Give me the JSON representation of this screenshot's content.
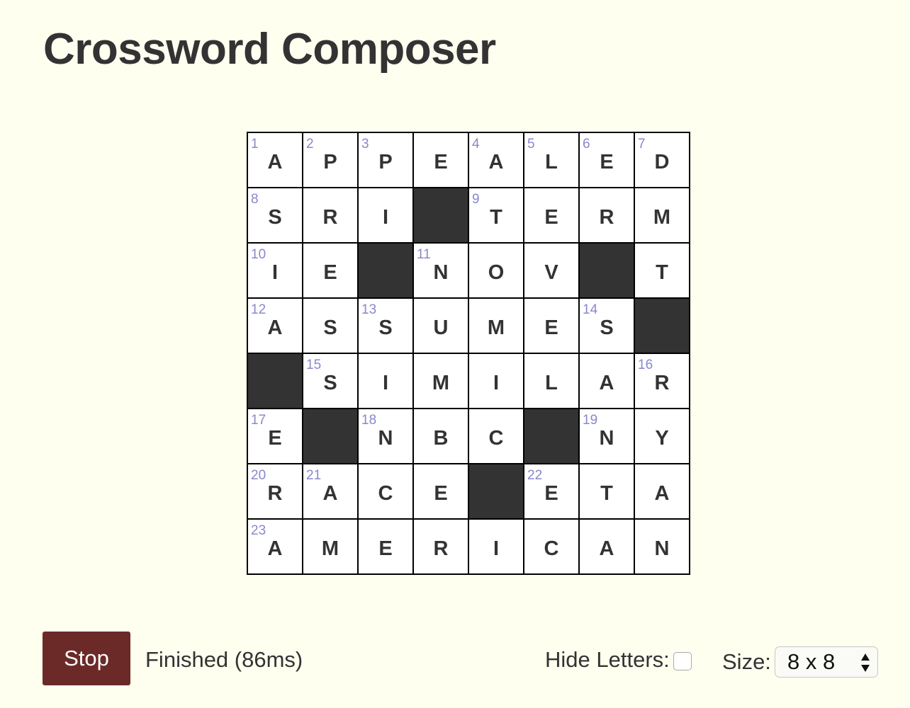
{
  "header": {
    "title": "Crossword Composer"
  },
  "grid": {
    "rows": 8,
    "cols": 8,
    "colors": {
      "black_cell": "#333333",
      "number": "#8888cc",
      "letter": "#333333"
    },
    "cells": [
      [
        {
          "n": "1",
          "l": "A"
        },
        {
          "n": "2",
          "l": "P"
        },
        {
          "n": "3",
          "l": "P"
        },
        {
          "n": "",
          "l": "E"
        },
        {
          "n": "4",
          "l": "A"
        },
        {
          "n": "5",
          "l": "L"
        },
        {
          "n": "6",
          "l": "E"
        },
        {
          "n": "7",
          "l": "D"
        }
      ],
      [
        {
          "n": "8",
          "l": "S"
        },
        {
          "n": "",
          "l": "R"
        },
        {
          "n": "",
          "l": "I"
        },
        {
          "black": true
        },
        {
          "n": "9",
          "l": "T"
        },
        {
          "n": "",
          "l": "E"
        },
        {
          "n": "",
          "l": "R"
        },
        {
          "n": "",
          "l": "M"
        }
      ],
      [
        {
          "n": "10",
          "l": "I"
        },
        {
          "n": "",
          "l": "E"
        },
        {
          "black": true
        },
        {
          "n": "11",
          "l": "N"
        },
        {
          "n": "",
          "l": "O"
        },
        {
          "n": "",
          "l": "V"
        },
        {
          "black": true
        },
        {
          "n": "",
          "l": "T"
        }
      ],
      [
        {
          "n": "12",
          "l": "A"
        },
        {
          "n": "",
          "l": "S"
        },
        {
          "n": "13",
          "l": "S"
        },
        {
          "n": "",
          "l": "U"
        },
        {
          "n": "",
          "l": "M"
        },
        {
          "n": "",
          "l": "E"
        },
        {
          "n": "14",
          "l": "S"
        },
        {
          "black": true
        }
      ],
      [
        {
          "black": true
        },
        {
          "n": "15",
          "l": "S"
        },
        {
          "n": "",
          "l": "I"
        },
        {
          "n": "",
          "l": "M"
        },
        {
          "n": "",
          "l": "I"
        },
        {
          "n": "",
          "l": "L"
        },
        {
          "n": "",
          "l": "A"
        },
        {
          "n": "16",
          "l": "R"
        }
      ],
      [
        {
          "n": "17",
          "l": "E"
        },
        {
          "black": true
        },
        {
          "n": "18",
          "l": "N"
        },
        {
          "n": "",
          "l": "B"
        },
        {
          "n": "",
          "l": "C"
        },
        {
          "black": true
        },
        {
          "n": "19",
          "l": "N"
        },
        {
          "n": "",
          "l": "Y"
        }
      ],
      [
        {
          "n": "20",
          "l": "R"
        },
        {
          "n": "21",
          "l": "A"
        },
        {
          "n": "",
          "l": "C"
        },
        {
          "n": "",
          "l": "E"
        },
        {
          "black": true
        },
        {
          "n": "22",
          "l": "E"
        },
        {
          "n": "",
          "l": "T"
        },
        {
          "n": "",
          "l": "A"
        }
      ],
      [
        {
          "n": "23",
          "l": "A"
        },
        {
          "n": "",
          "l": "M"
        },
        {
          "n": "",
          "l": "E"
        },
        {
          "n": "",
          "l": "R"
        },
        {
          "n": "",
          "l": "I"
        },
        {
          "n": "",
          "l": "C"
        },
        {
          "n": "",
          "l": "A"
        },
        {
          "n": "",
          "l": "N"
        }
      ]
    ]
  },
  "controls": {
    "stop_label": "Stop",
    "stop_color": "#6b2a28",
    "status": "Finished (86ms)",
    "hide_letters_label": "Hide Letters:",
    "hide_letters_checked": false,
    "size_label": "Size:",
    "size_value": "8 x 8",
    "size_icon": "updown-arrows-icon"
  }
}
